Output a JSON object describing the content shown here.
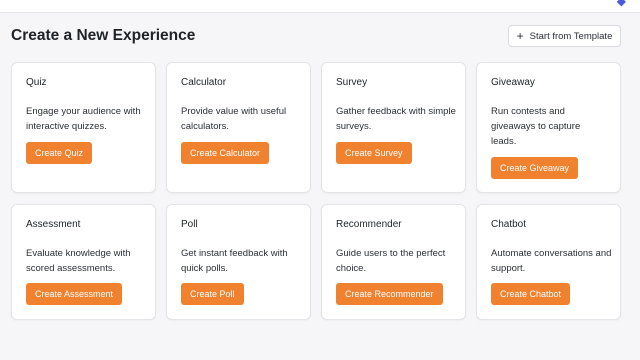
{
  "header": {
    "title": "Create a New Experience",
    "template_button": "Start from Template",
    "template_icon": "plus-icon"
  },
  "colors": {
    "accent": "#f0822f",
    "background": "#f6f6f8",
    "card": "#ffffff"
  },
  "cards": [
    {
      "title": "Quiz",
      "description": "Engage your audience with interactive quizzes.",
      "button": "Create Quiz"
    },
    {
      "title": "Calculator",
      "description": "Provide value with useful calculators.",
      "button": "Create Calculator"
    },
    {
      "title": "Survey",
      "description": "Gather feedback with simple surveys.",
      "button": "Create Survey"
    },
    {
      "title": "Giveaway",
      "description": "Run contests and giveaways to capture leads.",
      "button": "Create Giveaway"
    },
    {
      "title": "Assessment",
      "description": "Evaluate knowledge with scored assessments.",
      "button": "Create Assessment"
    },
    {
      "title": "Poll",
      "description": "Get instant feedback with quick polls.",
      "button": "Create Poll"
    },
    {
      "title": "Recommender",
      "description": "Guide users to the perfect choice.",
      "button": "Create Recommender"
    },
    {
      "title": "Chatbot",
      "description": "Automate conversations and support.",
      "button": "Create Chatbot"
    }
  ]
}
